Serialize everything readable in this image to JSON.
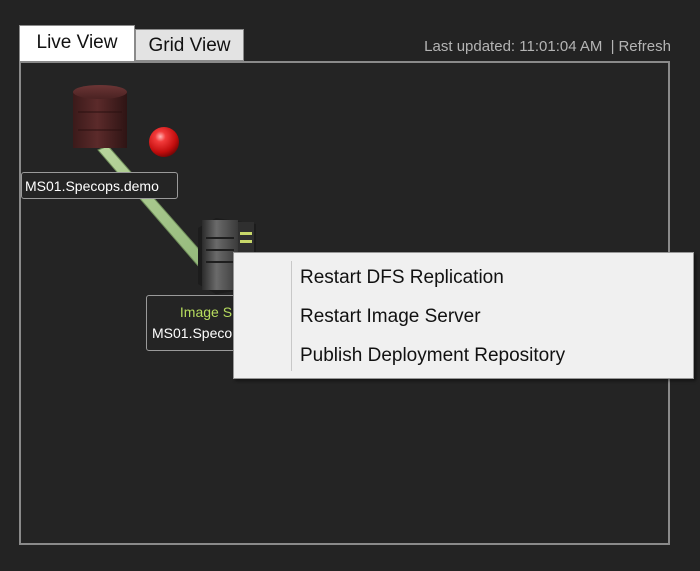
{
  "tabs": [
    {
      "label": "Live View",
      "selected": true
    },
    {
      "label": "Grid View",
      "selected": false
    }
  ],
  "status": {
    "last_updated_label": "Last updated:",
    "last_updated_time": "11:01:04 AM",
    "separator": "|",
    "refresh_label": "Refresh"
  },
  "nodes": [
    {
      "icon": "database-server-icon",
      "host": "MS01.Specops.demo",
      "status": "error",
      "status_color": "#d61b1b"
    },
    {
      "icon": "image-server-icon",
      "role": "Image S",
      "host": "MS01.Speco"
    }
  ],
  "context_menu": {
    "items": [
      {
        "label": "Restart DFS Replication"
      },
      {
        "label": "Restart Image Server"
      },
      {
        "label": "Publish Deployment Repository"
      }
    ]
  },
  "colors": {
    "background": "#232323",
    "connector": "#a9c98d",
    "role_text": "#b7dd5e",
    "error_indicator": "#d61b1b"
  }
}
